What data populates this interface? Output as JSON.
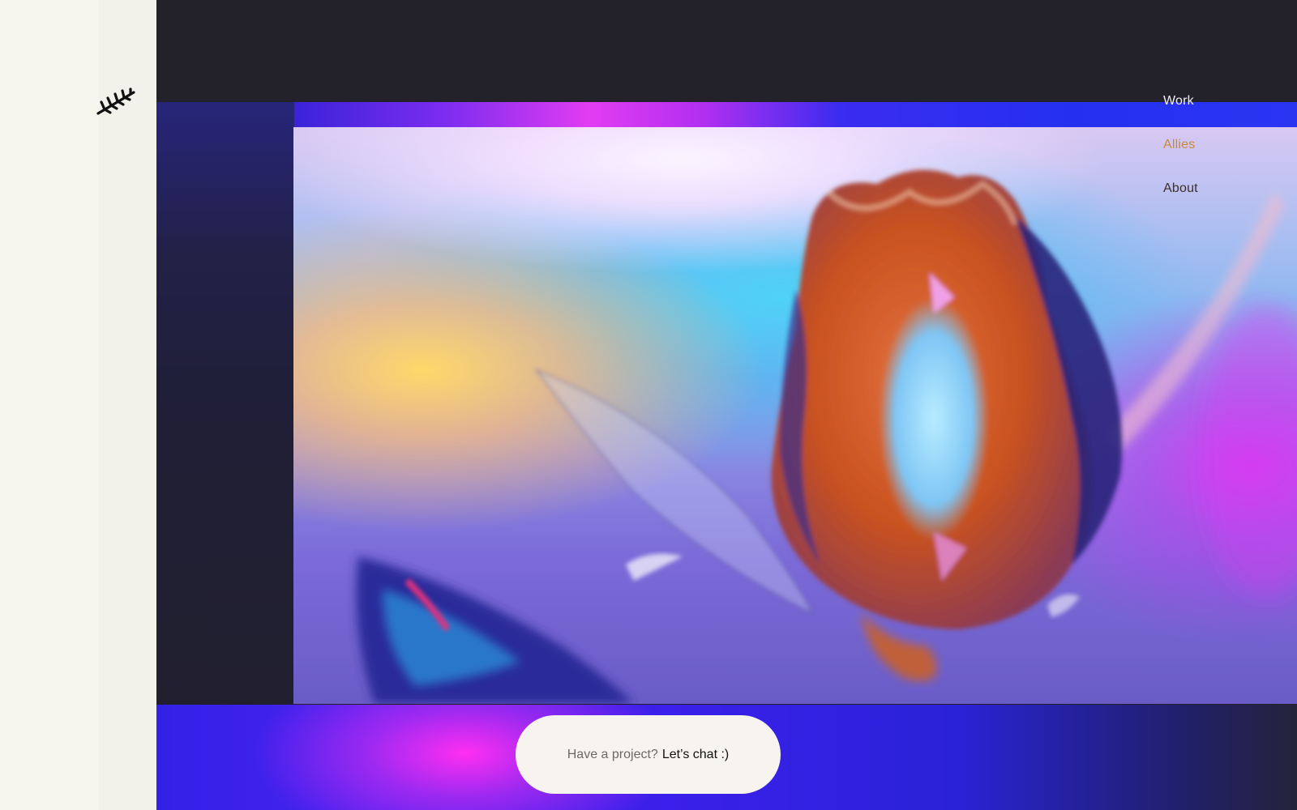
{
  "brand": {
    "logo_icon": "fern-sprig-icon",
    "logo_color": "#111111"
  },
  "nav": {
    "items": [
      {
        "label": "Work",
        "color": "#f3eef6"
      },
      {
        "label": "Allies",
        "color": "#c98a38"
      },
      {
        "label": "About",
        "color": "#3c2f28"
      }
    ]
  },
  "hero": {
    "media": "iridescent glass rosebud video still"
  },
  "cta": {
    "question": "Have a project?",
    "link_label": "Let’s chat :)"
  },
  "colors": {
    "sidebar": "#f7f6ee",
    "stage": "#221f29",
    "glow_magenta": "#ff2ef2",
    "glow_blue": "#3321e8",
    "cta_bg": "#f7f3ee"
  }
}
